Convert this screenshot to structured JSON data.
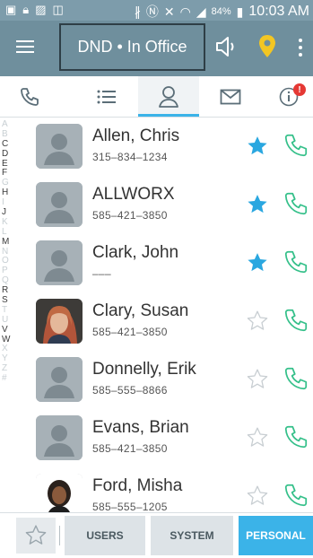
{
  "status_bar": {
    "battery": "84%",
    "time": "10:03 AM",
    "icons": [
      "picture-icon",
      "lock-icon",
      "image-icon",
      "voicemail-icon",
      "bluetooth-icon",
      "nfc-icon",
      "mute-icon",
      "wifi-icon",
      "signal-icon",
      "battery-icon"
    ]
  },
  "app_bar": {
    "title": "DND • In Office",
    "colors": {
      "bar": "#6f8f9d",
      "status": "#7d9cab",
      "pin": "#f3c623"
    }
  },
  "tabs": [
    {
      "name": "phone",
      "icon": "phone-icon"
    },
    {
      "name": "list",
      "icon": "list-icon"
    },
    {
      "name": "contacts",
      "icon": "person-icon",
      "active": true
    },
    {
      "name": "messages",
      "icon": "envelope-icon"
    },
    {
      "name": "info",
      "icon": "info-icon",
      "badge": "!"
    }
  ],
  "alphabet": [
    "A",
    "B",
    "C",
    "D",
    "E",
    "F",
    "G",
    "H",
    "I",
    "J",
    "K",
    "L",
    "M",
    "N",
    "O",
    "P",
    "Q",
    "R",
    "S",
    "T",
    "U",
    "V",
    "W",
    "X",
    "Y",
    "Z",
    "#"
  ],
  "alphabet_active": [
    "C",
    "D",
    "E",
    "F",
    "H",
    "J",
    "M",
    "R",
    "S",
    "V",
    "W"
  ],
  "contacts": [
    {
      "name": "Allen, Chris",
      "phone": "315–834–1234",
      "favorite": true,
      "photo": "placeholder"
    },
    {
      "name": "ALLWORX",
      "phone": "585–421–3850",
      "favorite": true,
      "photo": "placeholder"
    },
    {
      "name": "Clark, John",
      "phone": "–––",
      "favorite": true,
      "photo": "placeholder"
    },
    {
      "name": "Clary, Susan",
      "phone": "585–421–3850",
      "favorite": false,
      "photo": "woman-grey-hair"
    },
    {
      "name": "Donnelly, Erik",
      "phone": "585–555–8866",
      "favorite": false,
      "photo": "placeholder"
    },
    {
      "name": "Evans, Brian",
      "phone": "585–421–3850",
      "favorite": false,
      "photo": "placeholder"
    },
    {
      "name": "Ford, Misha",
      "phone": "585–555–1205",
      "favorite": false,
      "photo": "woman-dark-hair"
    }
  ],
  "bottom_bar": {
    "users_label": "USERS",
    "system_label": "SYSTEM",
    "personal_label": "PERSONAL",
    "active": "PERSONAL"
  },
  "colors": {
    "star_on": "#2aa7e0",
    "star_off": "#c8ced2",
    "call": "#35c08a",
    "accent": "#3bb3e8"
  }
}
